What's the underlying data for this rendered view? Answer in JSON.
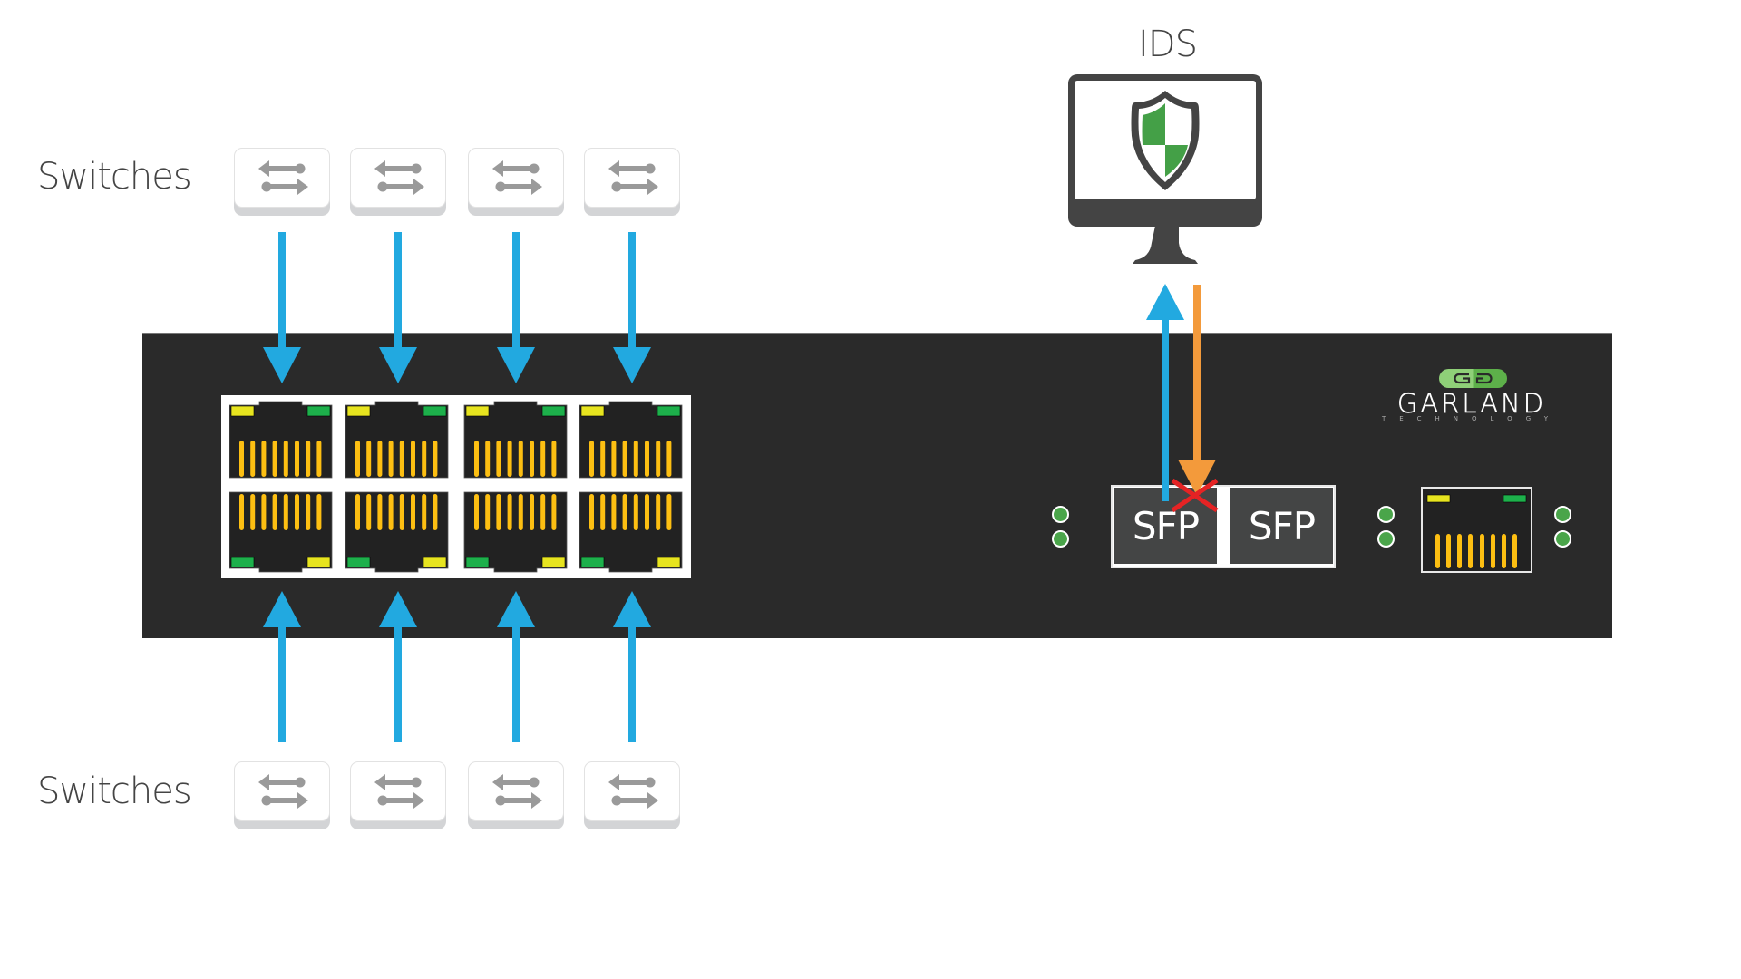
{
  "labels": {
    "switches_top": "Switches",
    "switches_bottom": "Switches",
    "ids": "IDS"
  },
  "top_switches": [
    {
      "icon": "switch-arrows-icon"
    },
    {
      "icon": "switch-arrows-icon"
    },
    {
      "icon": "switch-arrows-icon"
    },
    {
      "icon": "switch-arrows-icon"
    }
  ],
  "bottom_switches": [
    {
      "icon": "switch-arrows-icon"
    },
    {
      "icon": "switch-arrows-icon"
    },
    {
      "icon": "switch-arrows-icon"
    },
    {
      "icon": "switch-arrows-icon"
    }
  ],
  "device": {
    "brand": "GARLAND",
    "brand_sub": "TECHNOLOGY",
    "rj45_port_pairs": 4,
    "sfp_ports": [
      "SFP",
      "SFP"
    ],
    "monitor_port_blocked": true
  },
  "ids": {
    "icon": "shield-icon"
  },
  "colors": {
    "device_body": "#2a2a2a",
    "traffic_arrow": "#22a9e0",
    "return_arrow": "#f39a3b",
    "blocked_x": "#e52324",
    "led_green": "#4aa54a",
    "port_led_yellow": "#e7e41f",
    "port_led_green": "#1db04b",
    "pin_gold": "#fdbf12",
    "shield_green": "#44a047",
    "monitor_gray": "#444444"
  }
}
